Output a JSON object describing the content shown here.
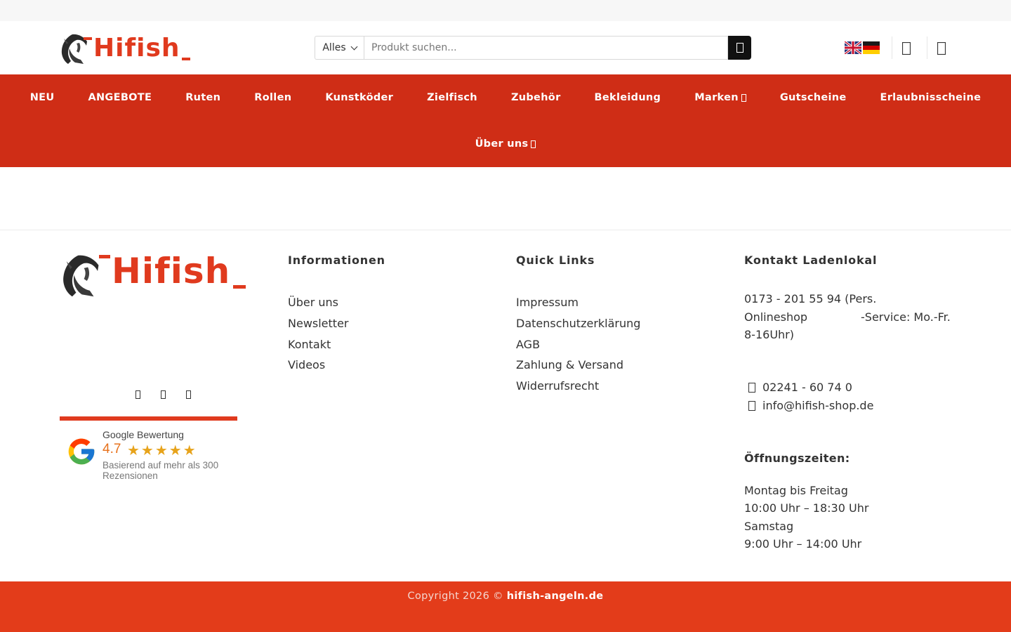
{
  "brand": {
    "name": "Hifish",
    "accent": "#cf2d16",
    "accent_light": "#e33c1a"
  },
  "search": {
    "category": "Alles",
    "placeholder": "Produkt suchen..."
  },
  "header_icons": [
    "en-flag",
    "de-flag",
    "account-icon",
    "cart-icon"
  ],
  "nav": {
    "row1": [
      "NEU",
      "ANGEBOTE",
      "Ruten",
      "Rollen",
      "Kunstköder",
      "Zielfisch",
      "Zubehör",
      "Bekleidung",
      "Marken",
      "Gutscheine",
      "Erlaubnisscheine"
    ],
    "row2": [
      "Über uns"
    ]
  },
  "footer": {
    "google": {
      "title": "Google Bewertung",
      "rating": "4.7",
      "stars": "★★★★★",
      "desc": "Basierend auf mehr als 300 Rezensionen"
    },
    "informationen": {
      "title": "Informationen",
      "links": [
        "Über uns",
        "Newsletter",
        "Kontakt",
        "Videos"
      ]
    },
    "quicklinks": {
      "title": "Quick Links",
      "links": [
        "Impressum",
        "Datenschutzerklärung",
        "AGB",
        "Zahlung & Versand",
        "Widerrufsrecht"
      ]
    },
    "kontakt": {
      "title": "Kontakt Ladenlokal",
      "phone_line1": "0173 - 201 55 94 (Pers.",
      "phone_line2a": "Onlineshop",
      "phone_line2b": "-Service: Mo.-Fr.",
      "phone_line3": "8-16Uhr)",
      "phone": "02241 - 60 74 0",
      "email": "info@hifish-shop.de",
      "hours_title": "Öffnungszeiten:",
      "hours": [
        "Montag bis Freitag",
        "10:00 Uhr – 18:30 Uhr",
        "Samstag",
        "9:00 Uhr – 14:00 Uhr"
      ]
    }
  },
  "copyright": {
    "prefix": "Copyright 2026 ©",
    "site": "hifish-angeln.de"
  }
}
